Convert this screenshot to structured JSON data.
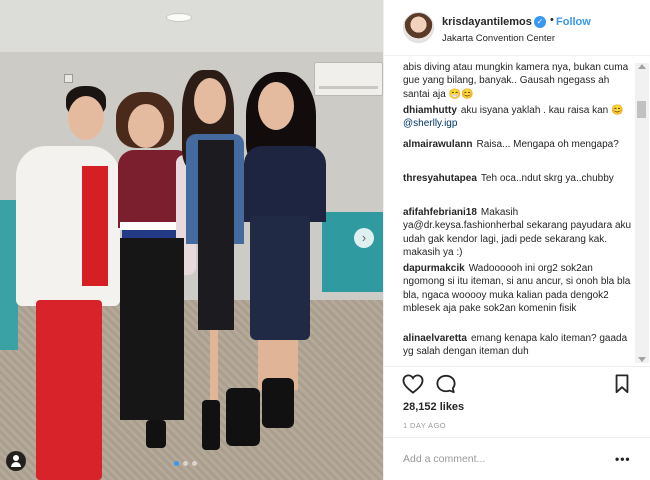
{
  "header": {
    "username": "krisdayantilemos",
    "separator": "•",
    "follow_label": "Follow",
    "location": "Jakarta Convention Center"
  },
  "comments": [
    {
      "user": "",
      "text": "abis diving atau mungkin kamera nya, bukan cuma gue yang bilang, banyak.. Gausah ngegass ah santai aja 😁😊"
    },
    {
      "user": "dhiamhutty",
      "text": "aku isyana yaklah . kau raisa kan 😊 ",
      "mention": "@sherlly.igp"
    },
    {
      "user": "almairawulann",
      "text": "Raisa... Mengapa oh mengapa?"
    },
    {
      "user": "thresyahutapea",
      "text": "Teh oca..ndut skrg ya..chubby"
    },
    {
      "user": "afifahfebriani18",
      "text": "Makasih ya@dr.keysa.fashionherbal sekarang payudara aku udah gak kendor lagi, jadi pede sekarang kak. makasih ya :)"
    },
    {
      "user": "dapurmakcik",
      "text": "Wadoooooh ini org2 sok2an ngomong si itu iteman, si anu ancur, si onoh bla bla bla, ngaca wooooy muka kalian pada dengok2 mblesek aja pake sok2an komenin fisik"
    },
    {
      "user": "alinaelvaretta",
      "text": "emang kenapa kalo iteman? gaada yg salah dengan iteman duh"
    }
  ],
  "likes": "28,152 likes",
  "time": "1 DAY AGO",
  "add_comment": {
    "placeholder": "Add a comment..."
  },
  "more_label": "•••",
  "carousel": {
    "next_label": "›",
    "slides": 3,
    "active": 0
  },
  "icons": {
    "like": "heart-icon",
    "comment": "comment-icon",
    "save": "bookmark-icon",
    "verified": "verified-badge-icon",
    "tag": "user-tag-icon"
  },
  "colors": {
    "accent": "#3897f0",
    "text": "#262626",
    "muted": "#999999"
  }
}
